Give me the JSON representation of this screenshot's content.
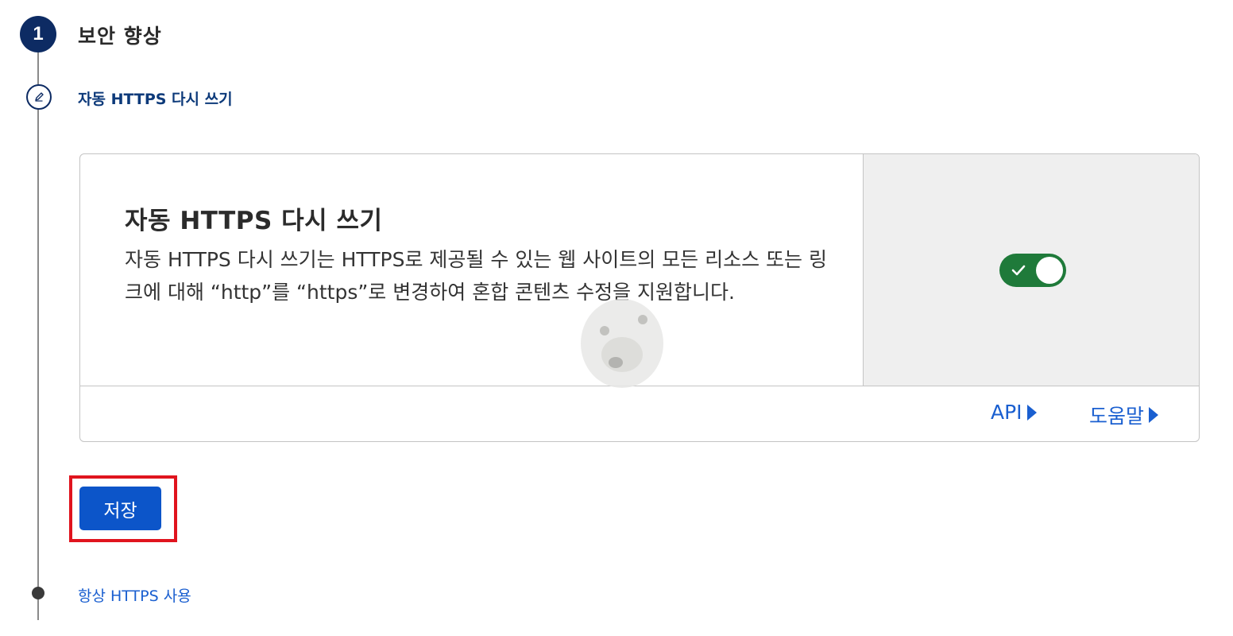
{
  "stepper": {
    "step_number": "1",
    "step_title": "보안 향상",
    "current_substep": "자동 HTTPS 다시 쓰기",
    "next_substep": "항상 HTTPS 사용"
  },
  "card": {
    "heading": "자동 HTTPS 다시 쓰기",
    "description": "자동 HTTPS 다시 쓰기는 HTTPS로 제공될 수 있는 웹 사이트의 모든 리소스 또는 링크에 대해 “http”를 “https”로 변경하여 혼합 콘텐츠 수정을 지원합니다.",
    "toggle_on": true,
    "links": {
      "api": "API",
      "help": "도움말"
    }
  },
  "actions": {
    "save_label": "저장"
  },
  "icons": {
    "edit": "pencil-icon",
    "toggle_check": "check-icon",
    "link_arrow": "triangle-right-icon"
  },
  "colors": {
    "step_badge": "#0d2b63",
    "toggle_on": "#1f7a3a",
    "save_button": "#0c55c9",
    "link": "#1a5fd0",
    "highlight": "#e0141e"
  }
}
